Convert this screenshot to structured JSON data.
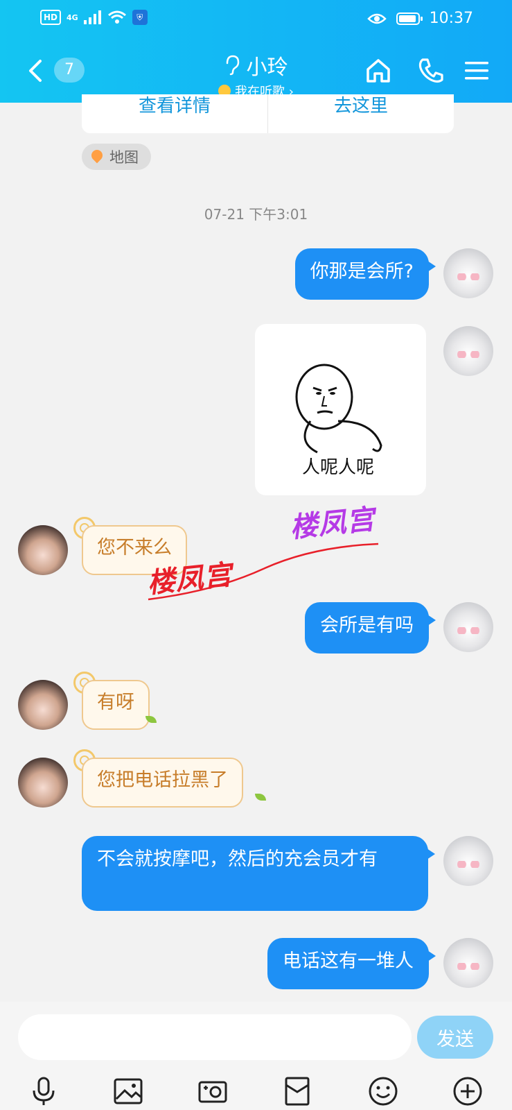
{
  "status_bar": {
    "hd": "HD",
    "network": "4G",
    "time": "10:37"
  },
  "header": {
    "back_count": "7",
    "contact_name": "小玲",
    "status_text": "我在听歌 ›"
  },
  "location_card": {
    "detail_button": "查看详情",
    "go_button": "去这里",
    "map_tag": "地图"
  },
  "chat": {
    "timestamp": "07-21 下午3:01",
    "messages": [
      {
        "from": "me",
        "text": "你那是会所?"
      },
      {
        "from": "me",
        "sticker_caption": "人呢人呢"
      },
      {
        "from": "her",
        "text": "您不来么"
      },
      {
        "from": "me",
        "text": "会所是有吗"
      },
      {
        "from": "her",
        "text": "有呀"
      },
      {
        "from": "her",
        "text": "您把电话拉黑了"
      },
      {
        "from": "me",
        "text": "不会就按摩吧，然后的充会员才有"
      },
      {
        "from": "me",
        "text": "电话这有一堆人"
      }
    ]
  },
  "watermarks": [
    "楼凤宫",
    "楼凤宫"
  ],
  "input": {
    "placeholder": "",
    "send_label": "发送"
  },
  "toolbar_icons": [
    "microphone-icon",
    "image-icon",
    "camera-icon",
    "red-packet-icon",
    "emoji-icon",
    "plus-icon"
  ],
  "colors": {
    "header": "#12a9f7",
    "out_bubble": "#1e90f5",
    "in_bubble_text": "#c77d2a"
  }
}
